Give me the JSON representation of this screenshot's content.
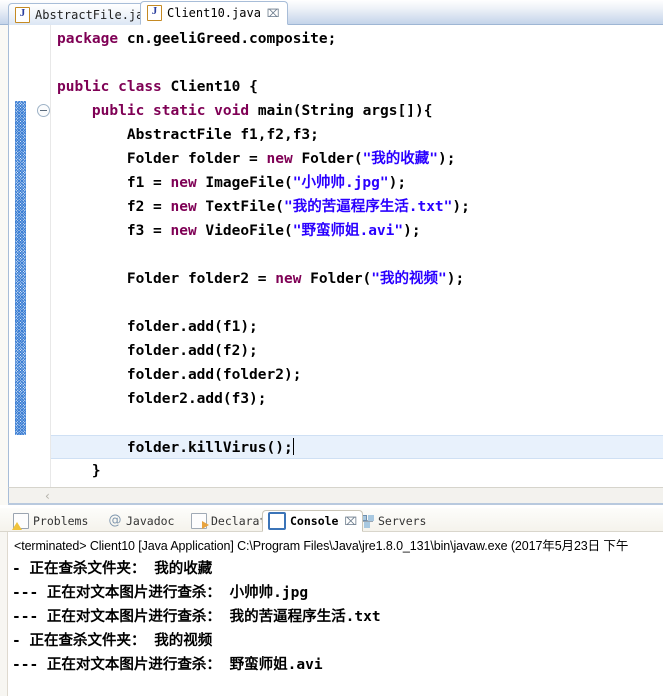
{
  "editor": {
    "tabs": [
      {
        "label": "AbstractFile.java",
        "icon": "java-file-icon",
        "active": false,
        "closable": false
      },
      {
        "label": "Client10.java",
        "icon": "java-file-icon",
        "active": true,
        "closable": true
      }
    ],
    "close_glyph": "⌧",
    "scroll_left_glyph": "‹",
    "code_lines": [
      {
        "segments": [
          {
            "t": "package",
            "c": "kw"
          },
          {
            "t": " cn.geeliGreed.composite;",
            "c": ""
          }
        ]
      },
      {
        "segments": [
          {
            "t": "",
            "c": ""
          }
        ]
      },
      {
        "segments": [
          {
            "t": "public",
            "c": "kw"
          },
          {
            "t": " ",
            "c": ""
          },
          {
            "t": "class",
            "c": "kw"
          },
          {
            "t": " Client10 {",
            "c": ""
          }
        ]
      },
      {
        "segments": [
          {
            "t": "    ",
            "c": ""
          },
          {
            "t": "public",
            "c": "kw"
          },
          {
            "t": " ",
            "c": ""
          },
          {
            "t": "static",
            "c": "kw"
          },
          {
            "t": " ",
            "c": ""
          },
          {
            "t": "void",
            "c": "kw"
          },
          {
            "t": " main(String args[]){",
            "c": ""
          }
        ]
      },
      {
        "segments": [
          {
            "t": "        AbstractFile f1,f2,f3;",
            "c": ""
          }
        ]
      },
      {
        "segments": [
          {
            "t": "        Folder folder = ",
            "c": ""
          },
          {
            "t": "new",
            "c": "kw"
          },
          {
            "t": " Folder(",
            "c": ""
          },
          {
            "t": "\"我的收藏\"",
            "c": "str"
          },
          {
            "t": ");",
            "c": ""
          }
        ]
      },
      {
        "segments": [
          {
            "t": "        f1 = ",
            "c": ""
          },
          {
            "t": "new",
            "c": "kw"
          },
          {
            "t": " ImageFile(",
            "c": ""
          },
          {
            "t": "\"小帅帅.jpg\"",
            "c": "str"
          },
          {
            "t": ");",
            "c": ""
          }
        ]
      },
      {
        "segments": [
          {
            "t": "        f2 = ",
            "c": ""
          },
          {
            "t": "new",
            "c": "kw"
          },
          {
            "t": " TextFile(",
            "c": ""
          },
          {
            "t": "\"我的苦逼程序生活.txt\"",
            "c": "str"
          },
          {
            "t": ");",
            "c": ""
          }
        ]
      },
      {
        "segments": [
          {
            "t": "        f3 = ",
            "c": ""
          },
          {
            "t": "new",
            "c": "kw"
          },
          {
            "t": " VideoFile(",
            "c": ""
          },
          {
            "t": "\"野蛮师姐.avi\"",
            "c": "str"
          },
          {
            "t": ");",
            "c": ""
          }
        ]
      },
      {
        "segments": [
          {
            "t": "",
            "c": ""
          }
        ]
      },
      {
        "segments": [
          {
            "t": "        Folder folder2 = ",
            "c": ""
          },
          {
            "t": "new",
            "c": "kw"
          },
          {
            "t": " Folder(",
            "c": ""
          },
          {
            "t": "\"我的视频\"",
            "c": "str"
          },
          {
            "t": ");",
            "c": ""
          }
        ]
      },
      {
        "segments": [
          {
            "t": "",
            "c": ""
          }
        ]
      },
      {
        "segments": [
          {
            "t": "        folder.add(f1);",
            "c": ""
          }
        ]
      },
      {
        "segments": [
          {
            "t": "        folder.add(f2);",
            "c": ""
          }
        ]
      },
      {
        "segments": [
          {
            "t": "        folder.add(folder2);",
            "c": ""
          }
        ]
      },
      {
        "segments": [
          {
            "t": "        folder2.add(f3);",
            "c": ""
          }
        ]
      },
      {
        "segments": [
          {
            "t": "",
            "c": ""
          }
        ]
      },
      {
        "current": true,
        "caret": true,
        "segments": [
          {
            "t": "        folder.killVirus();",
            "c": ""
          }
        ]
      },
      {
        "segments": [
          {
            "t": "    }",
            "c": ""
          }
        ]
      },
      {
        "segments": [
          {
            "t": "",
            "c": ""
          }
        ]
      },
      {
        "segments": [
          {
            "t": "}",
            "c": ""
          }
        ]
      }
    ]
  },
  "console": {
    "tabs": [
      {
        "label": "Problems",
        "icon": "problems-icon",
        "active": false,
        "closable": false
      },
      {
        "label": "Javadoc",
        "icon": "javadoc-icon",
        "active": false,
        "closable": false
      },
      {
        "label": "Declaration",
        "icon": "declaration-icon",
        "active": false,
        "closable": false
      },
      {
        "label": "Console",
        "icon": "console-icon",
        "active": true,
        "closable": true
      },
      {
        "label": "Servers",
        "icon": "servers-icon",
        "active": false,
        "closable": false
      }
    ],
    "close_glyph": "⌧",
    "terminated_line": "<terminated> Client10 [Java Application] C:\\Program Files\\Java\\jre1.8.0_131\\bin\\javaw.exe (2017年5月23日 下午",
    "output_lines": [
      "- 正在查杀文件夹： 我的收藏",
      "--- 正在对文本图片进行查杀： 小帅帅.jpg",
      "--- 正在对文本图片进行查杀： 我的苦逼程序生活.txt",
      "- 正在查杀文件夹： 我的视频",
      "--- 正在对文本图片进行查杀： 野蛮师姐.avi"
    ]
  },
  "colors": {
    "keyword": "#7F0055",
    "string": "#2A00FF",
    "current_line": "#E8F1FC",
    "tab_accent": "#C4D4EA"
  }
}
